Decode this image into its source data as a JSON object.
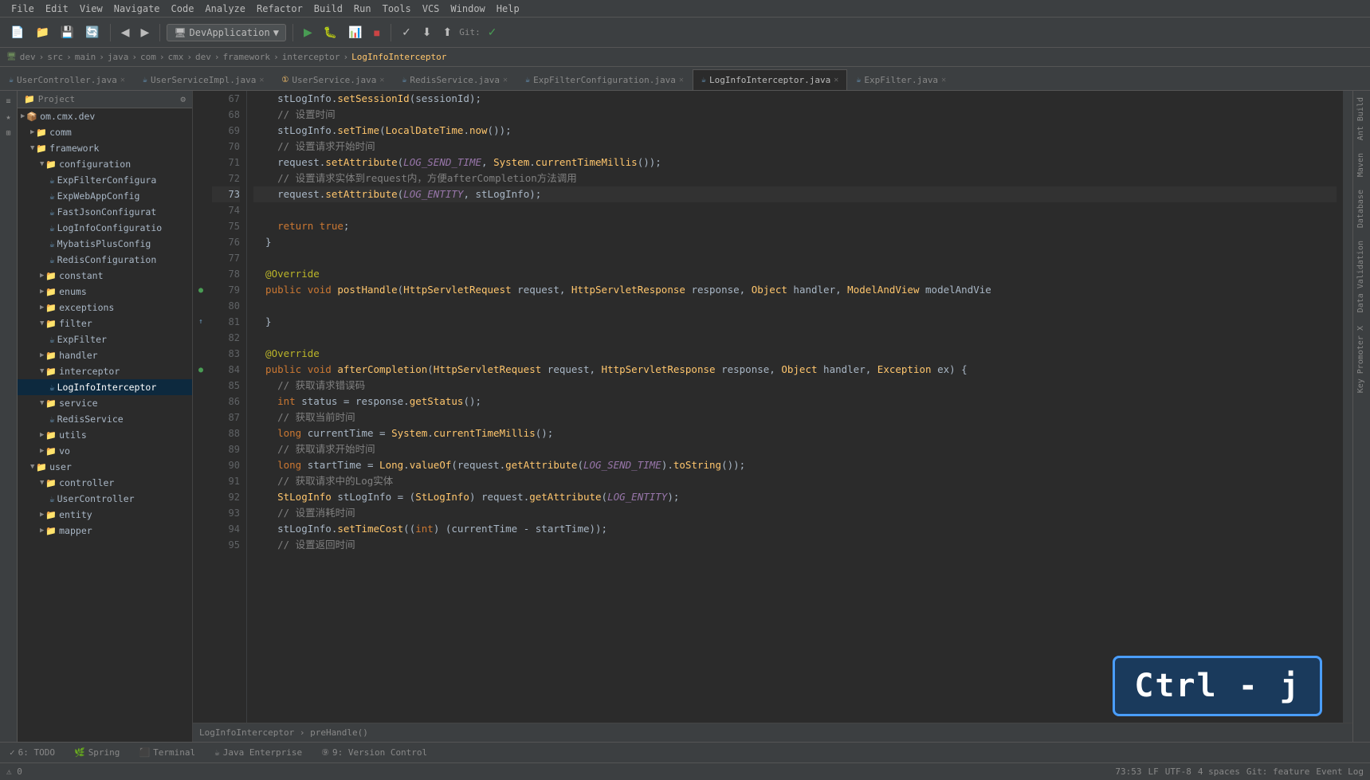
{
  "menuBar": {
    "items": [
      "File",
      "Edit",
      "View",
      "Navigate",
      "Code",
      "Analyze",
      "Refactor",
      "Build",
      "Run",
      "Tools",
      "VCS",
      "Window",
      "Help"
    ]
  },
  "toolbar": {
    "project": "DevApplication",
    "git_status": "Git:"
  },
  "breadcrumb": {
    "items": [
      "dev",
      "src",
      "main",
      "java",
      "com",
      "cmx",
      "dev",
      "framework",
      "interceptor",
      "LogInfoInterceptor"
    ]
  },
  "tabs": [
    {
      "id": "tab1",
      "label": "UserController.java",
      "type": "java",
      "active": false
    },
    {
      "id": "tab2",
      "label": "UserServiceImpl.java",
      "type": "java",
      "active": false
    },
    {
      "id": "tab3",
      "label": "UserService.java",
      "type": "interface",
      "active": false
    },
    {
      "id": "tab4",
      "label": "RedisService.java",
      "type": "java",
      "active": false
    },
    {
      "id": "tab5",
      "label": "ExpFilterConfiguration.java",
      "type": "java",
      "active": false
    },
    {
      "id": "tab6",
      "label": "LogInfoInterceptor.java",
      "type": "java",
      "active": true
    },
    {
      "id": "tab7",
      "label": "ExpFilter.java",
      "type": "java",
      "active": false
    }
  ],
  "projectTree": {
    "title": "Project",
    "items": [
      {
        "label": "om.cmx.dev",
        "indent": 0,
        "type": "package",
        "expanded": false
      },
      {
        "label": "comm",
        "indent": 1,
        "type": "folder",
        "expanded": false
      },
      {
        "label": "framework",
        "indent": 1,
        "type": "folder",
        "expanded": true
      },
      {
        "label": "configuration",
        "indent": 2,
        "type": "folder",
        "expanded": true
      },
      {
        "label": "ExpFilterConfigura",
        "indent": 3,
        "type": "java",
        "expanded": false
      },
      {
        "label": "ExpWebAppConfig",
        "indent": 3,
        "type": "java",
        "expanded": false
      },
      {
        "label": "FastJsonConfigurat",
        "indent": 3,
        "type": "java",
        "expanded": false
      },
      {
        "label": "LogInfoConfiguratio",
        "indent": 3,
        "type": "java",
        "expanded": false
      },
      {
        "label": "MybatisPlusConfig",
        "indent": 3,
        "type": "java",
        "expanded": false
      },
      {
        "label": "RedisConfiguration",
        "indent": 3,
        "type": "java",
        "expanded": false
      },
      {
        "label": "constant",
        "indent": 2,
        "type": "folder",
        "expanded": false
      },
      {
        "label": "enums",
        "indent": 2,
        "type": "folder",
        "expanded": false
      },
      {
        "label": "exceptions",
        "indent": 2,
        "type": "folder",
        "expanded": false
      },
      {
        "label": "filter",
        "indent": 2,
        "type": "folder",
        "expanded": true
      },
      {
        "label": "ExpFilter",
        "indent": 3,
        "type": "java",
        "expanded": false
      },
      {
        "label": "handler",
        "indent": 2,
        "type": "folder",
        "expanded": false
      },
      {
        "label": "interceptor",
        "indent": 2,
        "type": "folder",
        "expanded": true
      },
      {
        "label": "LogInfoInterceptor",
        "indent": 3,
        "type": "java",
        "expanded": false,
        "selected": true
      },
      {
        "label": "service",
        "indent": 2,
        "type": "folder",
        "expanded": true
      },
      {
        "label": "RedisService",
        "indent": 3,
        "type": "java",
        "expanded": false
      },
      {
        "label": "utils",
        "indent": 2,
        "type": "folder",
        "expanded": false
      },
      {
        "label": "vo",
        "indent": 2,
        "type": "folder",
        "expanded": false
      },
      {
        "label": "user",
        "indent": 1,
        "type": "folder",
        "expanded": true
      },
      {
        "label": "controller",
        "indent": 2,
        "type": "folder",
        "expanded": true
      },
      {
        "label": "UserController",
        "indent": 3,
        "type": "java",
        "expanded": false
      },
      {
        "label": "entity",
        "indent": 2,
        "type": "folder",
        "expanded": false
      },
      {
        "label": "mapper",
        "indent": 2,
        "type": "folder",
        "expanded": false
      }
    ]
  },
  "codeLines": [
    {
      "num": 67,
      "content": "    stLogInfo.setSessionId(sessionId);",
      "type": "code"
    },
    {
      "num": 68,
      "content": "    // 设置时间",
      "type": "comment"
    },
    {
      "num": 69,
      "content": "    stLogInfo.setTime(LocalDateTime.now());",
      "type": "code"
    },
    {
      "num": 70,
      "content": "    // 设置请求开始时间",
      "type": "comment"
    },
    {
      "num": 71,
      "content": "    request.setAttribute(LOG_SEND_TIME, System.currentTimeMillis());",
      "type": "code"
    },
    {
      "num": 72,
      "content": "    // 设置请求实体到request内，方便afterCompletion方法调用",
      "type": "comment"
    },
    {
      "num": 73,
      "content": "    request.setAttribute(LOG_ENTITY, stLogInfo);",
      "type": "code",
      "active": true
    },
    {
      "num": 74,
      "content": "",
      "type": "blank"
    },
    {
      "num": 75,
      "content": "    return true;",
      "type": "code"
    },
    {
      "num": 76,
      "content": "  }",
      "type": "code"
    },
    {
      "num": 77,
      "content": "",
      "type": "blank"
    },
    {
      "num": 78,
      "content": "  @Override",
      "type": "annotation"
    },
    {
      "num": 79,
      "content": "  public void postHandle(HttpServletRequest request, HttpServletResponse response, Object handler, ModelAndView modelAndVie",
      "type": "code",
      "gutter": "run"
    },
    {
      "num": 80,
      "content": "",
      "type": "blank"
    },
    {
      "num": 81,
      "content": "  }",
      "type": "code",
      "gutter": "override"
    },
    {
      "num": 82,
      "content": "",
      "type": "blank"
    },
    {
      "num": 83,
      "content": "  @Override",
      "type": "annotation"
    },
    {
      "num": 84,
      "content": "  public void afterCompletion(HttpServletRequest request, HttpServletResponse response, Object handler, Exception ex) {",
      "type": "code",
      "gutter": "run"
    },
    {
      "num": 85,
      "content": "    // 获取请求错误码",
      "type": "comment"
    },
    {
      "num": 86,
      "content": "    int status = response.getStatus();",
      "type": "code"
    },
    {
      "num": 87,
      "content": "    // 获取当前时间",
      "type": "comment"
    },
    {
      "num": 88,
      "content": "    long currentTime = System.currentTimeMillis();",
      "type": "code"
    },
    {
      "num": 89,
      "content": "    // 获取请求开始时间",
      "type": "comment"
    },
    {
      "num": 90,
      "content": "    long startTime = Long.valueOf(request.getAttribute(LOG_SEND_TIME).toString());",
      "type": "code"
    },
    {
      "num": 91,
      "content": "    // 获取请求中的Log实体",
      "type": "comment"
    },
    {
      "num": 92,
      "content": "    StLogInfo stLogInfo = (StLogInfo) request.getAttribute(LOG_ENTITY);",
      "type": "code"
    },
    {
      "num": 93,
      "content": "    // 设置消耗时间",
      "type": "comment"
    },
    {
      "num": 94,
      "content": "    stLogInfo.setTimeCost((int) (currentTime - startTime));",
      "type": "code"
    },
    {
      "num": 95,
      "content": "    // 设置返回时间",
      "type": "comment"
    }
  ],
  "bottomBar": {
    "breadcrumb": "LogInfoInterceptor › preHandle()",
    "statusItems": {
      "position": "73:53",
      "lineEnding": "LF",
      "encoding": "UTF-8",
      "indent": "4 spaces",
      "branch": "Git: feature"
    },
    "tools": [
      "6: TODO",
      "Spring",
      "Terminal",
      "Java Enterprise",
      "9: Version Control"
    ],
    "eventLog": "Event Log"
  },
  "rightPanels": [
    "Ant Build",
    "Maven",
    "Database",
    "Data Validation",
    "Key Promoter X"
  ],
  "shortcutOverlay": "Ctrl - j"
}
